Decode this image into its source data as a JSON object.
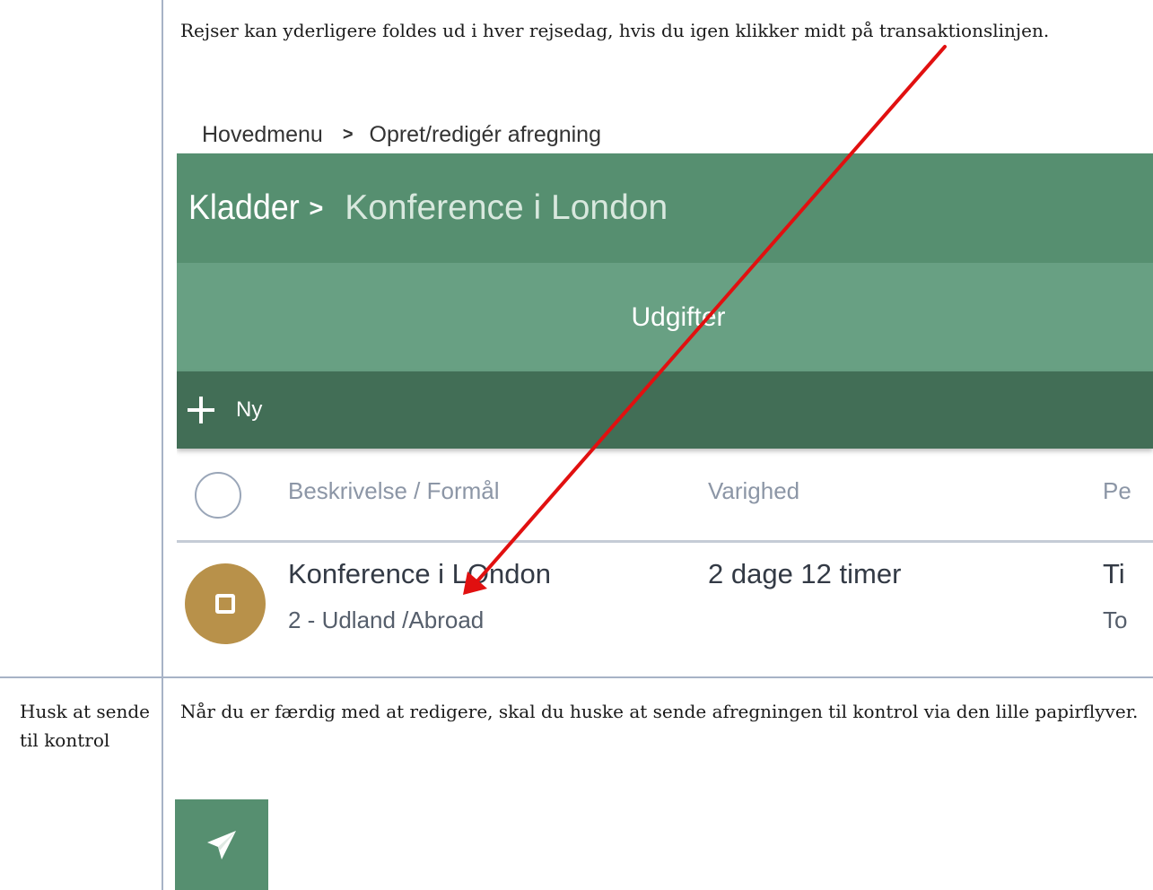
{
  "row1": {
    "paragraph": "Rejser kan yderligere foldes ud i hver rejsedag, hvis du igen klikker midt på transaktionslinjen."
  },
  "app": {
    "breadcrumb": {
      "home": "Hovedmenu",
      "separator": ">",
      "current": "Opret/redigér afregning"
    },
    "title": {
      "main": "Kladder",
      "separator": ">",
      "sub": "Konference i London"
    },
    "tab": {
      "label": "Udgifter"
    },
    "toolbar": {
      "new_label": "Ny"
    },
    "table": {
      "columns": [
        "Beskrivelse / Formål",
        "Varighed",
        "Pe"
      ],
      "rows": [
        {
          "description": "Konference i LOndon",
          "category": "2 - Udland /Abroad",
          "duration": "2 dage 12 timer",
          "period_partial": "Ti",
          "period_sub_partial": "To"
        }
      ]
    },
    "colors": {
      "title_bar": "#568f70",
      "tab_bar": "#68a083",
      "action_bar": "#426e56",
      "avatar": "#b8914a",
      "annotation_arrow": "#e11010"
    }
  },
  "row2": {
    "label": "Husk at sende til kontrol",
    "paragraph": "Når du er færdig med at redigere, skal du huske at sende afregningen til kontrol via den lille papirflyver.",
    "send_icon": "paper-plane-icon"
  }
}
